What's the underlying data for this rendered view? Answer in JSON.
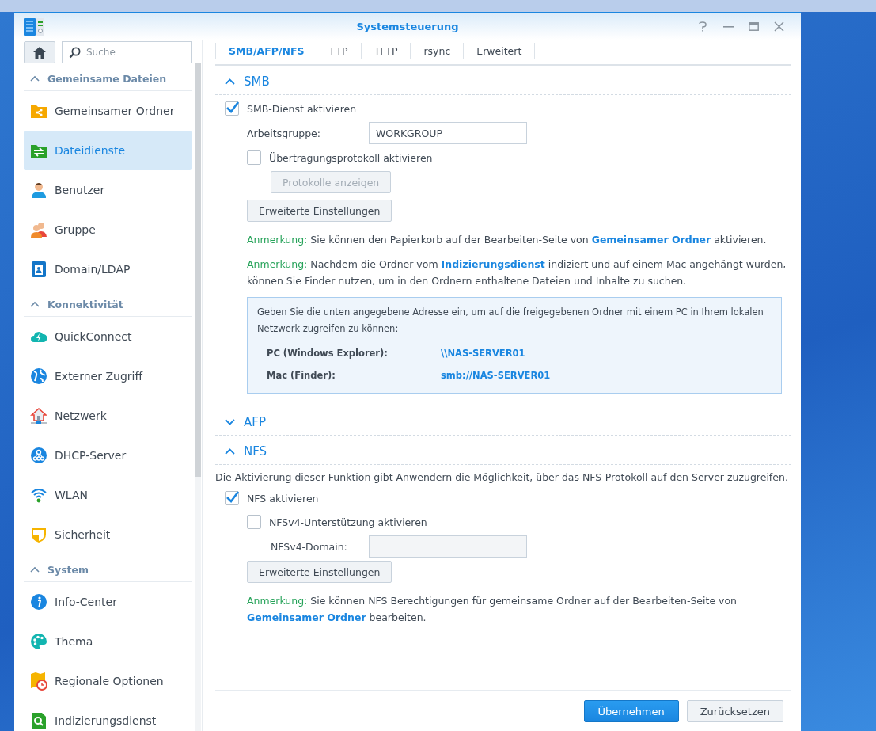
{
  "window": {
    "title": "Systemsteuerung"
  },
  "sidebar": {
    "search": {
      "placeholder": "Suche"
    },
    "groups": [
      {
        "label": "Gemeinsame Dateien",
        "expanded": true,
        "items": [
          {
            "label": "Gemeinsamer Ordner",
            "selected": false
          },
          {
            "label": "Dateidienste",
            "selected": true
          },
          {
            "label": "Benutzer",
            "selected": false
          },
          {
            "label": "Gruppe",
            "selected": false
          },
          {
            "label": "Domain/LDAP",
            "selected": false
          }
        ]
      },
      {
        "label": "Konnektivität",
        "expanded": true,
        "items": [
          {
            "label": "QuickConnect",
            "selected": false
          },
          {
            "label": "Externer Zugriff",
            "selected": false
          },
          {
            "label": "Netzwerk",
            "selected": false
          },
          {
            "label": "DHCP-Server",
            "selected": false
          },
          {
            "label": "WLAN",
            "selected": false
          },
          {
            "label": "Sicherheit",
            "selected": false
          }
        ]
      },
      {
        "label": "System",
        "expanded": true,
        "items": [
          {
            "label": "Info-Center",
            "selected": false
          },
          {
            "label": "Thema",
            "selected": false
          },
          {
            "label": "Regionale Optionen",
            "selected": false
          },
          {
            "label": "Indizierungsdienst",
            "selected": false
          }
        ]
      }
    ]
  },
  "tabs": [
    {
      "label": "SMB/AFP/NFS",
      "selected": true
    },
    {
      "label": "FTP",
      "selected": false
    },
    {
      "label": "TFTP",
      "selected": false
    },
    {
      "label": "rsync",
      "selected": false
    },
    {
      "label": "Erweitert",
      "selected": false
    }
  ],
  "sections": [
    {
      "title": "SMB",
      "expanded": true,
      "content": [
        {
          "kind": "checkbox",
          "label": "SMB-Dienst aktivieren",
          "checked": true,
          "children": [
            {
              "kind": "field",
              "label": "Arbeitsgruppe:",
              "value": "WORKGROUP",
              "disabled": false
            },
            {
              "kind": "checkbox",
              "label": "Übertragungsprotokoll aktivieren",
              "checked": false,
              "children": [
                {
                  "kind": "button",
                  "label": "Protokolle anzeigen",
                  "disabled": true
                }
              ]
            },
            {
              "kind": "button",
              "label": "Erweiterte Einstellungen",
              "disabled": false
            },
            {
              "kind": "note",
              "parts": [
                {
                  "kind": "label",
                  "text": "Anmerkung:"
                },
                {
                  "kind": "text",
                  "text": " Sie können den Papierkorb auf der Bearbeiten-Seite von "
                },
                {
                  "kind": "link",
                  "text": "Gemeinsamer Ordner"
                },
                {
                  "kind": "text",
                  "text": " aktivieren."
                }
              ]
            },
            {
              "kind": "note",
              "parts": [
                {
                  "kind": "label",
                  "text": "Anmerkung:"
                },
                {
                  "kind": "text",
                  "text": " Nachdem die Ordner vom "
                },
                {
                  "kind": "link",
                  "text": "Indizierungsdienst"
                },
                {
                  "kind": "text",
                  "text": " indiziert und auf einem Mac angehängt wurden, können Sie Finder nutzen, um in den Ordnern enthaltene Dateien und Inhalte zu suchen."
                }
              ]
            },
            {
              "kind": "info_box",
              "text": "Geben Sie die unten angegebene Adresse ein, um auf die freigegebenen Ordner mit einem PC in Ihrem lokalen Netzwerk zugreifen zu können:",
              "rows": [
                {
                  "label": "PC (Windows Explorer):",
                  "value": "\\\\NAS-SERVER01"
                },
                {
                  "label": "Mac (Finder):",
                  "value": "smb://NAS-SERVER01"
                }
              ]
            }
          ]
        }
      ]
    },
    {
      "title": "AFP",
      "expanded": false
    },
    {
      "title": "NFS",
      "expanded": true,
      "content": [
        {
          "kind": "text",
          "text": "Die Aktivierung dieser Funktion gibt Anwendern die Möglichkeit, über das NFS-Protokoll auf den Server zuzugreifen."
        },
        {
          "kind": "checkbox",
          "label": "NFS aktivieren",
          "checked": true,
          "children": [
            {
              "kind": "checkbox",
              "label": "NFSv4-Unterstützung aktivieren",
              "checked": false,
              "children": [
                {
                  "kind": "field",
                  "label": "NFSv4-Domain:",
                  "disabled": true
                }
              ]
            },
            {
              "kind": "button",
              "label": "Erweiterte Einstellungen",
              "disabled": false
            },
            {
              "kind": "note",
              "parts": [
                {
                  "kind": "label",
                  "text": "Anmerkung:"
                },
                {
                  "kind": "text",
                  "text": " Sie können NFS Berechtigungen für gemeinsame Ordner auf der Bearbeiten-Seite von "
                },
                {
                  "kind": "link",
                  "text": "Gemeinsamer Ordner"
                },
                {
                  "kind": "text",
                  "text": " bearbeiten."
                }
              ]
            }
          ]
        }
      ]
    }
  ],
  "footer": {
    "buttons": [
      {
        "label": "Übernehmen",
        "kind": "primary"
      },
      {
        "label": "Zurücksetzen",
        "kind": "secondary"
      }
    ]
  }
}
